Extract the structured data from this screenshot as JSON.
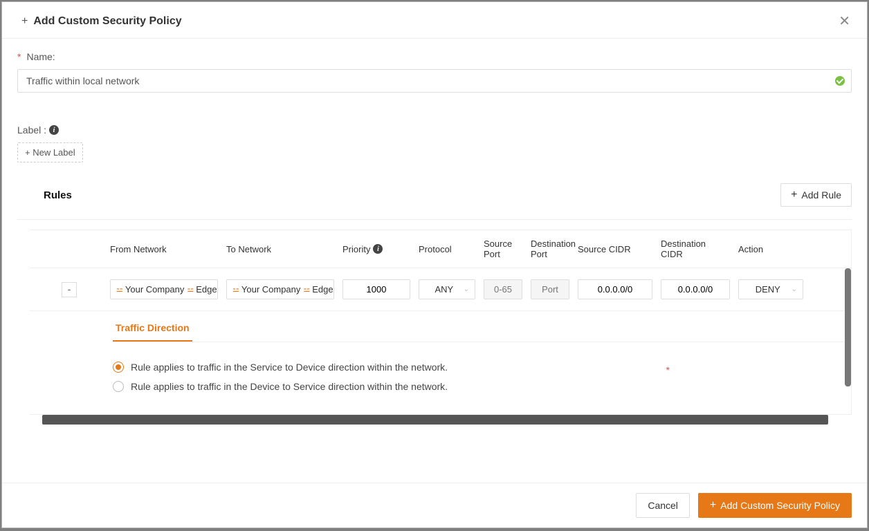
{
  "header": {
    "title": "Add Custom Security Policy"
  },
  "form": {
    "name_label": "Name:",
    "name_value": "Traffic within local network",
    "label_label": "Label :",
    "new_label_btn": "+ New Label"
  },
  "rules": {
    "section_title": "Rules",
    "add_rule_btn": "Add Rule",
    "columns": {
      "from_network": "From Network",
      "to_network": "To Network",
      "priority": "Priority",
      "protocol": "Protocol",
      "source_port": "Source Port",
      "destination_port": "Destination Port",
      "source_cidr": "Source CIDR",
      "destination_cidr": "Destination CIDR",
      "action": "Action"
    },
    "row": {
      "from_network_a": "Your Company",
      "from_network_b": "Edge",
      "to_network_a": "Your Company",
      "to_network_b": "Edge",
      "priority": "1000",
      "protocol": "ANY",
      "source_port_placeholder": "0-65",
      "destination_port_placeholder": "Port",
      "source_cidr": "0.0.0.0/0",
      "destination_cidr": "0.0.0.0/0",
      "action": "DENY"
    },
    "detail": {
      "tab_label": "Traffic Direction",
      "radio1": "Rule applies to traffic in the Service to Device direction within the network.",
      "radio2": "Rule applies to traffic in the Device to Service direction within the network.",
      "selected": 0
    }
  },
  "footer": {
    "cancel": "Cancel",
    "submit": "Add Custom Security Policy"
  }
}
